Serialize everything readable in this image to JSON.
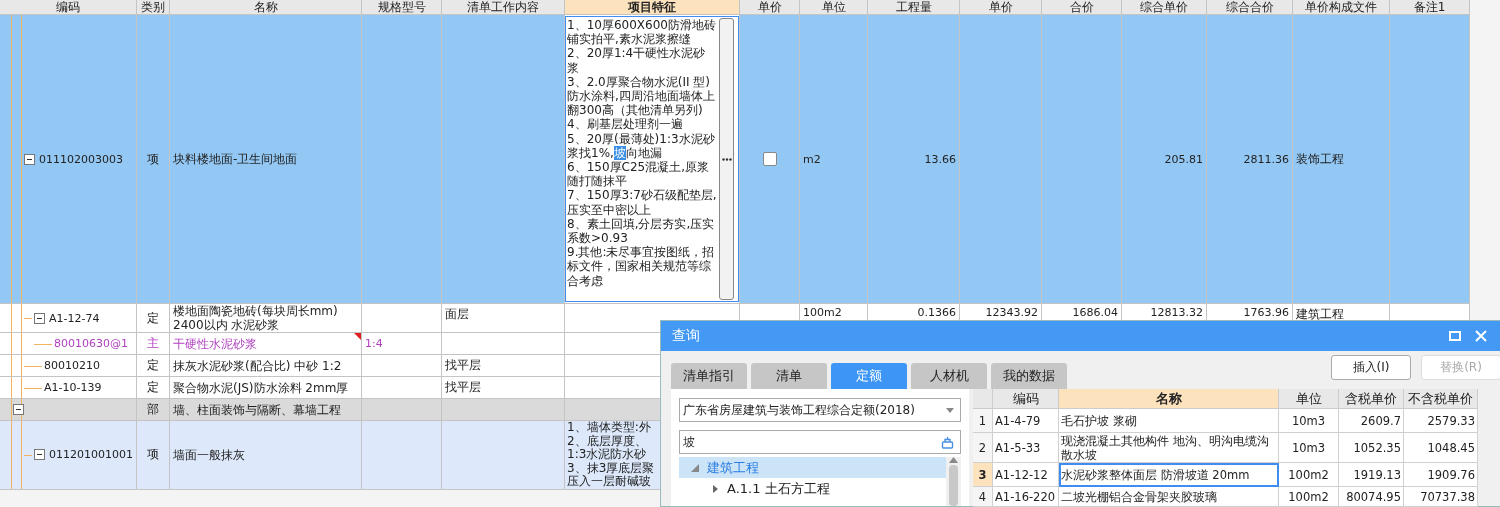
{
  "grid": {
    "columns": [
      {
        "label": "编码",
        "active": false
      },
      {
        "label": "类别",
        "active": false
      },
      {
        "label": "名称",
        "active": false
      },
      {
        "label": "规格型号",
        "active": false
      },
      {
        "label": "清单工作内容",
        "active": false
      },
      {
        "label": "项目特征",
        "active": true
      },
      {
        "label": "单价",
        "active": false
      },
      {
        "label": "单位",
        "active": false
      },
      {
        "label": "工程量",
        "active": false
      },
      {
        "label": "单价",
        "active": false
      },
      {
        "label": "合价",
        "active": false
      },
      {
        "label": "综合单价",
        "active": false
      },
      {
        "label": "综合合价",
        "active": false
      },
      {
        "label": "单价构成文件",
        "active": false
      },
      {
        "label": "备注1",
        "active": false
      }
    ],
    "rows": [
      {
        "kind": "item",
        "selected": true,
        "expanded": true,
        "has_note": false,
        "code": "011102003003",
        "category": "项",
        "name": "块料楼地面-卫生间地面",
        "features": {
          "editing": true,
          "segments": [
            {
              "text": "1、10厚600X600防滑地砖铺实拍平,素水泥浆擦缝\n2、20厚1:4干硬性水泥砂浆\n3、2.0厚聚合物水泥(II 型)防水涂料,四周沿地面墙体上翻300高（其他清单另列)\n4、刷基层处理剂一遍\n5、20厚(最薄处)1:3水泥砂浆找1%,",
              "highlighted": false
            },
            {
              "text": "坡",
              "highlighted": true
            },
            {
              "text": "向地漏\n6、150厚C25混凝土,原浆随打随抹平\n7、150厚3:7砂石级配垫层,压实至中密以上\n8、素土回填,分层夯实,压实系数>0.93\n9.其他:未尽事宜按图纸，招标文件，国家相关规范等综合考虑",
              "highlighted": false
            }
          ]
        },
        "locked": false,
        "unit": "m2",
        "quantity": "13.66",
        "comp_unit_price": "205.81",
        "comp_total": "2811.36",
        "price_file": "装饰工程",
        "children": [
          {
            "kind": "quota",
            "selected": false,
            "expanded": true,
            "has_note": false,
            "code": "A1-12-74",
            "category": "定",
            "name": "楼地面陶瓷地砖(每块周长mm) 2400以内 水泥砂浆",
            "work_content": "面层",
            "unit": "100m2",
            "quantity": "0.1366",
            "unit_price": "12343.92",
            "total": "1686.04",
            "comp_unit_price": "12813.32",
            "comp_total": "1763.96",
            "price_file": "建筑工程",
            "children": [
              {
                "kind": "material",
                "selected": false,
                "has_note": true,
                "code": "80010630@1",
                "category": "主",
                "name": "干硬性水泥砂浆",
                "spec": "1:4"
              }
            ]
          },
          {
            "kind": "quota",
            "selected": false,
            "has_note": false,
            "code": "80010210",
            "category": "定",
            "name": "抹灰水泥砂浆(配合比) 中砂 1:2",
            "work_content": "找平层"
          },
          {
            "kind": "quota",
            "selected": false,
            "has_note": false,
            "code": "A1-10-139",
            "category": "定",
            "name": "聚合物水泥(JS)防水涂料 2mm厚",
            "work_content": "找平层"
          }
        ]
      },
      {
        "kind": "section",
        "selected": false,
        "expanded": true,
        "has_note": false,
        "category": "部",
        "name": "墙、柱面装饰与隔断、幕墙工程",
        "children": [
          {
            "kind": "item",
            "selected": false,
            "expanded": true,
            "has_note": false,
            "code": "011201001001",
            "category": "项",
            "name": "墙面一般抹灰",
            "features": {
              "editing": false,
              "lines": [
                "1、墙体类型:外",
                "2、底层厚度、",
                "1:3水泥防水砂",
                "3、抹3厚底层聚",
                "压入一层耐碱玻"
              ]
            }
          }
        ]
      }
    ]
  },
  "dialog": {
    "title": "查询",
    "tabs": [
      {
        "label": "清单指引",
        "selected": false
      },
      {
        "label": "清单",
        "selected": false
      },
      {
        "label": "定额",
        "selected": true
      },
      {
        "label": "人材机",
        "selected": false
      },
      {
        "label": "我的数据",
        "selected": false
      }
    ],
    "buttons": [
      {
        "label": "插入(I)",
        "disabled": false
      },
      {
        "label": "替换(R)",
        "disabled": true
      }
    ],
    "library": "广东省房屋建筑与装饰工程综合定额(2018)",
    "search": {
      "value": "坡"
    },
    "tree": [
      {
        "label": "建筑工程",
        "expanded": true,
        "selected": true,
        "children": [
          {
            "label": "A.1.1 土石方工程",
            "expanded": false,
            "selected": false
          }
        ]
      }
    ],
    "table": {
      "columns": [
        {
          "label": "编码",
          "active": false
        },
        {
          "label": "名称",
          "active": true
        },
        {
          "label": "单位",
          "active": false
        },
        {
          "label": "含税单价",
          "active": false
        },
        {
          "label": "不含税单价",
          "active": false
        }
      ],
      "rows": [
        {
          "number": "1",
          "code": "A1-4-79",
          "name": "毛石护坡 浆砌",
          "unit": "10m3",
          "price_with_tax": "2609.7",
          "price_without_tax": "2579.33",
          "selected": false
        },
        {
          "number": "2",
          "code": "A1-5-33",
          "name": "现浇混凝土其他构件 地沟、明沟电缆沟散水坡",
          "unit": "10m3",
          "price_with_tax": "1052.35",
          "price_without_tax": "1048.45",
          "selected": false
        },
        {
          "number": "3",
          "code": "A1-12-12",
          "name": "水泥砂浆整体面层 防滑坡道 20mm",
          "unit": "100m2",
          "price_with_tax": "1919.13",
          "price_without_tax": "1909.76",
          "selected": true
        },
        {
          "number": "4",
          "code": "A1-16-220",
          "name": "二坡光棚铝合金骨架夹胶玻璃",
          "unit": "100m2",
          "price_with_tax": "80074.95",
          "price_without_tax": "70737.38",
          "selected": false
        }
      ]
    }
  }
}
